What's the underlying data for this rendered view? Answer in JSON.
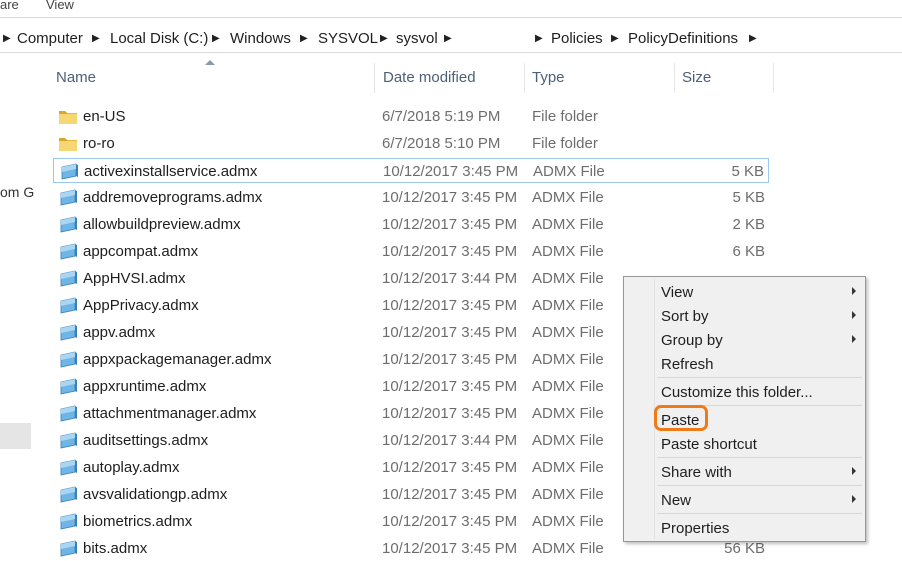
{
  "ribbon": {
    "share_label": "are",
    "view_label": "View"
  },
  "address": {
    "crumbs": [
      "Computer",
      "Local Disk (C:)",
      "Windows",
      "SYSVOL",
      "sysvol",
      "Policies",
      "PolicyDefinitions"
    ]
  },
  "left_nav": {
    "fragment": "om G"
  },
  "columns": {
    "name": "Name",
    "date": "Date modified",
    "type": "Type",
    "size": "Size"
  },
  "rows": [
    {
      "name": "en-US",
      "date": "6/7/2018 5:19 PM",
      "type": "File folder",
      "size": "",
      "icon": "folder-icon"
    },
    {
      "name": "ro-ro",
      "date": "6/7/2018 5:10 PM",
      "type": "File folder",
      "size": "",
      "icon": "folder-icon"
    },
    {
      "name": "activexinstallservice.admx",
      "date": "10/12/2017 3:45 PM",
      "type": "ADMX File",
      "size": "5 KB",
      "icon": "admx-file-icon"
    },
    {
      "name": "addremoveprograms.admx",
      "date": "10/12/2017 3:45 PM",
      "type": "ADMX File",
      "size": "5 KB",
      "icon": "admx-file-icon"
    },
    {
      "name": "allowbuildpreview.admx",
      "date": "10/12/2017 3:45 PM",
      "type": "ADMX File",
      "size": "2 KB",
      "icon": "admx-file-icon"
    },
    {
      "name": "appcompat.admx",
      "date": "10/12/2017 3:45 PM",
      "type": "ADMX File",
      "size": "6 KB",
      "icon": "admx-file-icon"
    },
    {
      "name": "AppHVSI.admx",
      "date": "10/12/2017 3:44 PM",
      "type": "ADMX File",
      "size": "",
      "icon": "admx-file-icon"
    },
    {
      "name": "AppPrivacy.admx",
      "date": "10/12/2017 3:45 PM",
      "type": "ADMX File",
      "size": "",
      "icon": "admx-file-icon"
    },
    {
      "name": "appv.admx",
      "date": "10/12/2017 3:45 PM",
      "type": "ADMX File",
      "size": "",
      "icon": "admx-file-icon"
    },
    {
      "name": "appxpackagemanager.admx",
      "date": "10/12/2017 3:45 PM",
      "type": "ADMX File",
      "size": "",
      "icon": "admx-file-icon"
    },
    {
      "name": "appxruntime.admx",
      "date": "10/12/2017 3:45 PM",
      "type": "ADMX File",
      "size": "",
      "icon": "admx-file-icon"
    },
    {
      "name": "attachmentmanager.admx",
      "date": "10/12/2017 3:45 PM",
      "type": "ADMX File",
      "size": "",
      "icon": "admx-file-icon"
    },
    {
      "name": "auditsettings.admx",
      "date": "10/12/2017 3:44 PM",
      "type": "ADMX File",
      "size": "",
      "icon": "admx-file-icon"
    },
    {
      "name": "autoplay.admx",
      "date": "10/12/2017 3:45 PM",
      "type": "ADMX File",
      "size": "",
      "icon": "admx-file-icon"
    },
    {
      "name": "avsvalidationgp.admx",
      "date": "10/12/2017 3:45 PM",
      "type": "ADMX File",
      "size": "",
      "icon": "admx-file-icon"
    },
    {
      "name": "biometrics.admx",
      "date": "10/12/2017 3:45 PM",
      "type": "ADMX File",
      "size": "",
      "icon": "admx-file-icon"
    },
    {
      "name": "bits.admx",
      "date": "10/12/2017 3:45 PM",
      "type": "ADMX File",
      "size": "56 KB",
      "icon": "admx-file-icon"
    }
  ],
  "context_menu": {
    "items": [
      {
        "label": "View",
        "submenu": true
      },
      {
        "label": "Sort by",
        "submenu": true
      },
      {
        "label": "Group by",
        "submenu": true
      },
      {
        "label": "Refresh",
        "submenu": false
      },
      {
        "label": "Customize this folder...",
        "submenu": false
      },
      {
        "label": "Paste",
        "submenu": false,
        "highlighted": true
      },
      {
        "label": "Paste shortcut",
        "submenu": false
      },
      {
        "label": "Share with",
        "submenu": true
      },
      {
        "label": "New",
        "submenu": true
      },
      {
        "label": "Properties",
        "submenu": false
      }
    ]
  },
  "colors": {
    "highlight": "#f07a1a",
    "header_text": "#4c607a",
    "focus_border": "#99c9ef"
  }
}
